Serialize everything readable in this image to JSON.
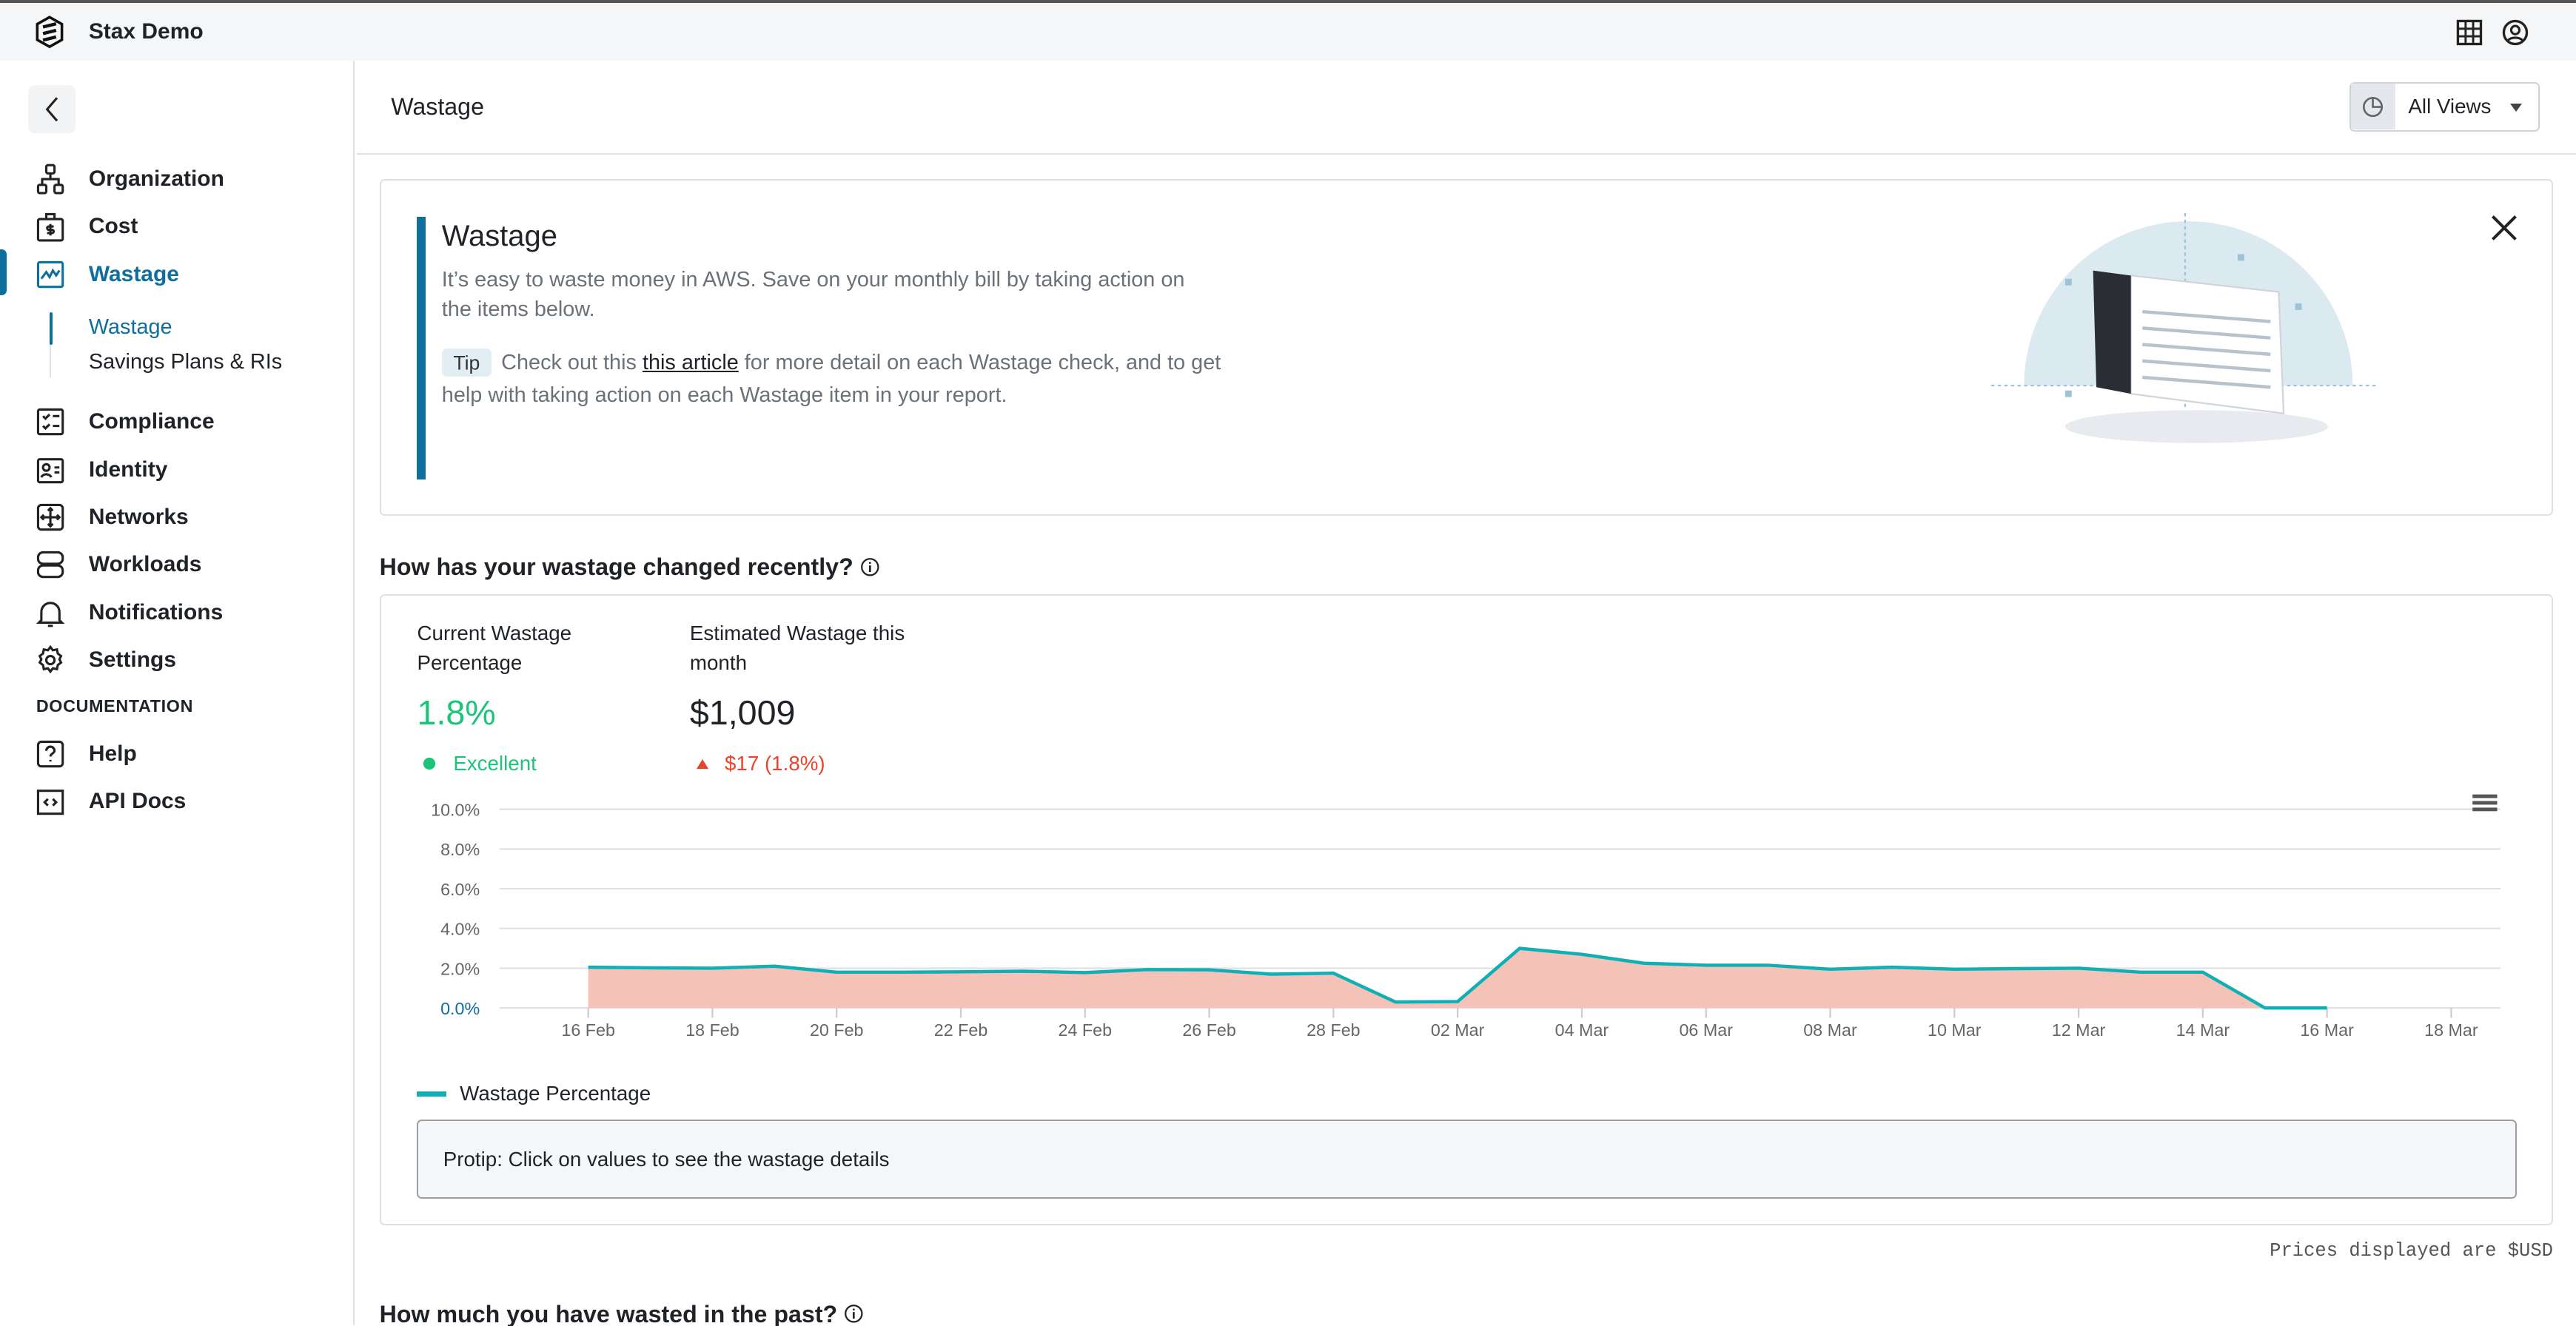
{
  "app": {
    "title": "Stax Demo"
  },
  "sidebar": {
    "items": [
      {
        "label": "Organization",
        "icon": "org-chart-icon"
      },
      {
        "label": "Cost",
        "icon": "cost-bag-icon"
      },
      {
        "label": "Wastage",
        "icon": "wastage-chart-icon",
        "active": true
      },
      {
        "label": "Compliance",
        "icon": "checklist-icon"
      },
      {
        "label": "Identity",
        "icon": "id-card-icon"
      },
      {
        "label": "Networks",
        "icon": "network-arrows-icon"
      },
      {
        "label": "Workloads",
        "icon": "server-icon"
      },
      {
        "label": "Notifications",
        "icon": "bell-icon"
      },
      {
        "label": "Settings",
        "icon": "gear-icon"
      }
    ],
    "subitems": [
      {
        "label": "Wastage",
        "active": true
      },
      {
        "label": "Savings Plans & RIs"
      }
    ],
    "docs_heading": "DOCUMENTATION",
    "doc_items": [
      {
        "label": "Help",
        "icon": "help-icon"
      },
      {
        "label": "API Docs",
        "icon": "api-docs-icon"
      }
    ]
  },
  "header": {
    "title": "Wastage",
    "views_label": "All Views"
  },
  "banner": {
    "title": "Wastage",
    "desc": "It’s easy to waste money in AWS. Save on your monthly bill by taking action on the items below.",
    "tip_badge": "Tip",
    "tip_pre": "Check out this ",
    "tip_link": "this article",
    "tip_post": " for more detail on each Wastage check, and to get help with taking action on each Wastage item in your report."
  },
  "section1": {
    "title": "How has your wastage changed recently?"
  },
  "kpis": {
    "current_label": "Current Wastage Percentage",
    "current_value": "1.8%",
    "current_status": "Excellent",
    "estimated_label": "Estimated Wastage this month",
    "estimated_value": "$1,009",
    "estimated_change": "$17 (1.8%)"
  },
  "colors": {
    "accent": "#0e6e9c",
    "good": "#1cc47a",
    "bad": "#e8442d",
    "line": "#0fb0b5",
    "area": "#f5c2b8"
  },
  "chart_data": {
    "type": "area",
    "x": [
      "16 Feb",
      "17 Feb",
      "18 Feb",
      "19 Feb",
      "20 Feb",
      "21 Feb",
      "22 Feb",
      "23 Feb",
      "24 Feb",
      "25 Feb",
      "26 Feb",
      "27 Feb",
      "28 Feb",
      "01 Mar",
      "02 Mar",
      "03 Mar",
      "04 Mar",
      "05 Mar",
      "06 Mar",
      "07 Mar",
      "08 Mar",
      "09 Mar",
      "10 Mar",
      "11 Mar",
      "12 Mar",
      "13 Mar",
      "14 Mar",
      "15 Mar",
      "16 Mar"
    ],
    "series": [
      {
        "name": "Wastage Percentage",
        "values": [
          2.05,
          2.02,
          2.0,
          2.1,
          1.8,
          1.8,
          1.82,
          1.85,
          1.78,
          1.93,
          1.92,
          1.7,
          1.75,
          0.3,
          0.32,
          3.0,
          2.7,
          2.25,
          2.15,
          2.15,
          1.95,
          2.05,
          1.95,
          1.98,
          2.0,
          1.8,
          1.8,
          0.0,
          0.0
        ]
      }
    ],
    "xticks": [
      "16 Feb",
      "18 Feb",
      "20 Feb",
      "22 Feb",
      "24 Feb",
      "26 Feb",
      "28 Feb",
      "02 Mar",
      "04 Mar",
      "06 Mar",
      "08 Mar",
      "10 Mar",
      "12 Mar",
      "14 Mar",
      "16 Mar",
      "18 Mar"
    ],
    "yticks": [
      "0.0%",
      "2.0%",
      "4.0%",
      "6.0%",
      "8.0%",
      "10.0%"
    ],
    "ylim": [
      0,
      10
    ],
    "grid": true,
    "legend": "bottom-left"
  },
  "protip": "Protip: Click on values to see the wastage details",
  "prices_note": "Prices displayed are $USD",
  "section2": {
    "title": "How much you have wasted in the past?"
  }
}
